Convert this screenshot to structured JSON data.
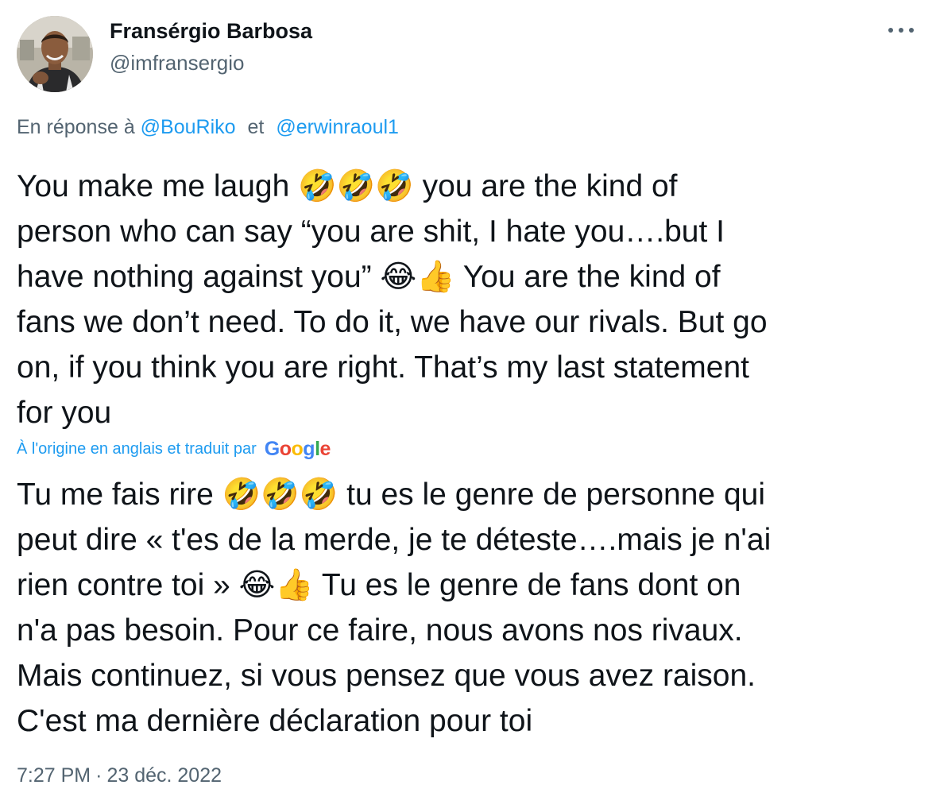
{
  "author": {
    "display_name": "Fransérgio Barbosa",
    "handle": "@imfransergio",
    "avatar_icon": "profile-photo"
  },
  "menu": {
    "icon": "more-horizontal-icon"
  },
  "reply": {
    "prefix": "En réponse à",
    "mentions": [
      "@BouRiko",
      "@erwinraoul1"
    ],
    "conjunction": "et"
  },
  "text_original": "You make me laugh 🤣🤣🤣 you are the kind of\nperson who can say “you are shit, I hate you….but I\nhave nothing against you” 😂👍 You are the kind of\nfans we don’t need. To do it, we have our rivals. But go\non, if you think you are right. That’s my last statement\nfor you",
  "translation": {
    "label": "À l'origine en anglais et traduit par",
    "provider": "Google",
    "provider_letters": [
      "G",
      "o",
      "o",
      "g",
      "l",
      "e"
    ],
    "provider_colors": [
      "#4285f4",
      "#ea4335",
      "#fbbc05",
      "#4285f4",
      "#34a853",
      "#ea4335"
    ],
    "text": "Tu me fais rire 🤣🤣🤣 tu es le genre de personne qui\npeut dire « t'es de la merde, je te déteste….mais je n'ai\nrien contre toi » 😂👍 Tu es le genre de fans dont on\nn'a pas besoin. Pour ce faire, nous avons nos rivaux.\nMais continuez, si vous pensez que vous avez raison.\nC'est ma dernière déclaration pour toi"
  },
  "meta": {
    "time": "7:27 PM",
    "separator": "·",
    "date": "23 déc. 2022"
  },
  "colors": {
    "text_primary": "#0f1419",
    "text_secondary": "#536471",
    "accent": "#1d9bf0"
  }
}
